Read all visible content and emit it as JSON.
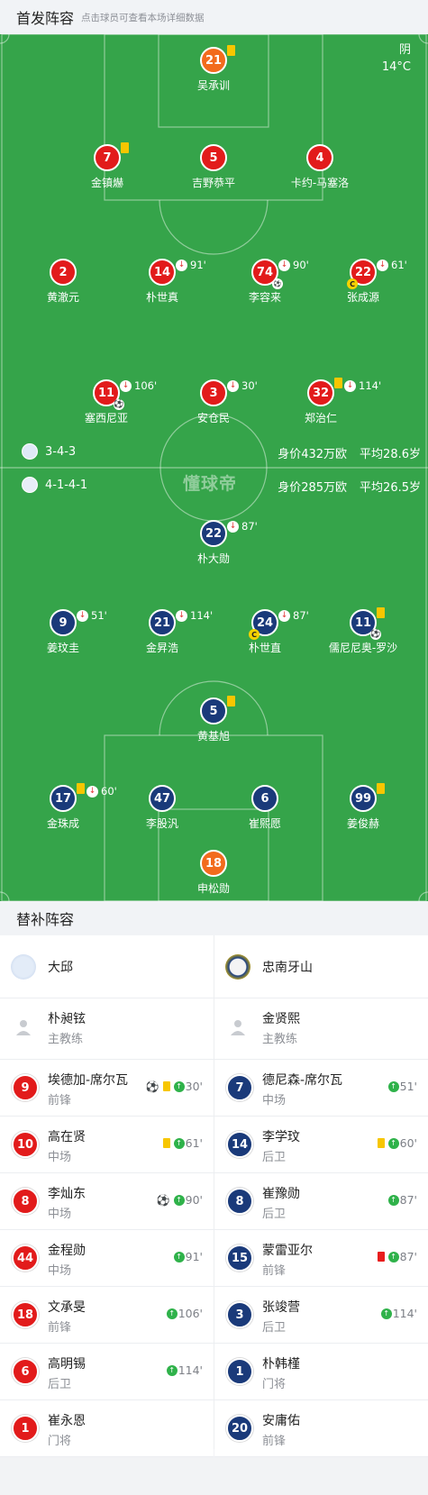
{
  "lineup": {
    "title": "首发阵容",
    "hint": "点击球员可查看本场详细数据"
  },
  "weather": {
    "cond": "阴",
    "temp": "14°C"
  },
  "watermark": "懂球帝",
  "home": {
    "formation": "3-4-3",
    "value": "身价432万欧",
    "age": "平均28.6岁",
    "team": "大邱"
  },
  "away": {
    "formation": "4-1-4-1",
    "value": "身价285万欧",
    "age": "平均26.5岁",
    "team": "忠南牙山"
  },
  "home_players": [
    {
      "num": "21",
      "name": "吴承训",
      "kind": "gk",
      "yc": true
    },
    {
      "num": "7",
      "name": "金镇爀",
      "kind": "home",
      "yc": true
    },
    {
      "num": "5",
      "name": "吉野恭平",
      "kind": "home"
    },
    {
      "num": "4",
      "name": "卡约-马塞洛",
      "kind": "home"
    },
    {
      "num": "2",
      "name": "黄澈元",
      "kind": "home"
    },
    {
      "num": "14",
      "name": "朴世真",
      "kind": "home",
      "sub": "91'"
    },
    {
      "num": "74",
      "name": "李容来",
      "kind": "home",
      "sub": "90'",
      "og": true
    },
    {
      "num": "22",
      "name": "张成源",
      "kind": "home",
      "sub": "61'",
      "cap": true
    },
    {
      "num": "11",
      "name": "塞西尼亚",
      "kind": "home",
      "sub": "106'",
      "goal": true
    },
    {
      "num": "3",
      "name": "安仓民",
      "kind": "home",
      "sub": "30'"
    },
    {
      "num": "32",
      "name": "郑治仁",
      "kind": "home",
      "sub": "114'",
      "yc": true
    }
  ],
  "away_players": [
    {
      "num": "22",
      "name": "朴大勋",
      "kind": "away",
      "sub": "87'"
    },
    {
      "num": "9",
      "name": "姜玟圭",
      "kind": "away",
      "sub": "51'"
    },
    {
      "num": "21",
      "name": "金昇浩",
      "kind": "away",
      "sub": "114'"
    },
    {
      "num": "24",
      "name": "朴世直",
      "kind": "away",
      "sub": "87'",
      "cap": true
    },
    {
      "num": "11",
      "name": "儒尼尼奥-罗沙",
      "kind": "away",
      "yc": true,
      "goal": true
    },
    {
      "num": "5",
      "name": "黄基旭",
      "kind": "away",
      "yc": true
    },
    {
      "num": "17",
      "name": "金珠成",
      "kind": "away",
      "sub": "60'",
      "yc": true
    },
    {
      "num": "47",
      "name": "李股汎",
      "kind": "away"
    },
    {
      "num": "6",
      "name": "崔熙愿",
      "kind": "away"
    },
    {
      "num": "99",
      "name": "姜俊赫",
      "kind": "away",
      "yc": true
    },
    {
      "num": "18",
      "name": "申松勋",
      "kind": "gk"
    }
  ],
  "subs": {
    "title": "替补阵容",
    "home_coach": {
      "name": "朴昶铉",
      "role": "主教练"
    },
    "away_coach": {
      "name": "金贤熙",
      "role": "主教练"
    },
    "home": [
      {
        "num": "9",
        "name": "埃德加-席尔瓦",
        "pos": "前锋",
        "goal": true,
        "yc": true,
        "min": "30'"
      },
      {
        "num": "10",
        "name": "高在贤",
        "pos": "中场",
        "yc": true,
        "min": "61'"
      },
      {
        "num": "8",
        "name": "李灿东",
        "pos": "中场",
        "goal": true,
        "min": "90'"
      },
      {
        "num": "44",
        "name": "金程勋",
        "pos": "中场",
        "min": "91'"
      },
      {
        "num": "18",
        "name": "文承旻",
        "pos": "前锋",
        "min": "106'"
      },
      {
        "num": "6",
        "name": "高明锡",
        "pos": "后卫",
        "min": "114'"
      },
      {
        "num": "1",
        "name": "崔永恩",
        "pos": "门将"
      }
    ],
    "away": [
      {
        "num": "7",
        "name": "德尼森-席尔瓦",
        "pos": "中场",
        "min": "51'"
      },
      {
        "num": "14",
        "name": "李学玟",
        "pos": "后卫",
        "yc": true,
        "min": "60'"
      },
      {
        "num": "8",
        "name": "崔豫勋",
        "pos": "后卫",
        "min": "87'"
      },
      {
        "num": "15",
        "name": "蒙雷亚尔",
        "pos": "前锋",
        "rc": true,
        "min": "87'"
      },
      {
        "num": "3",
        "name": "张竣营",
        "pos": "后卫",
        "min": "114'"
      },
      {
        "num": "1",
        "name": "朴韩槿",
        "pos": "门将"
      },
      {
        "num": "20",
        "name": "安庸佑",
        "pos": "前锋"
      }
    ]
  },
  "colors": {
    "pitch": "#35a44a",
    "home": "#e21b1b",
    "away": "#1a3a7a",
    "gk": "#f26b1d",
    "yellow": "#f7c600",
    "red": "#e81d1d",
    "subIn": "#2fb24a"
  }
}
